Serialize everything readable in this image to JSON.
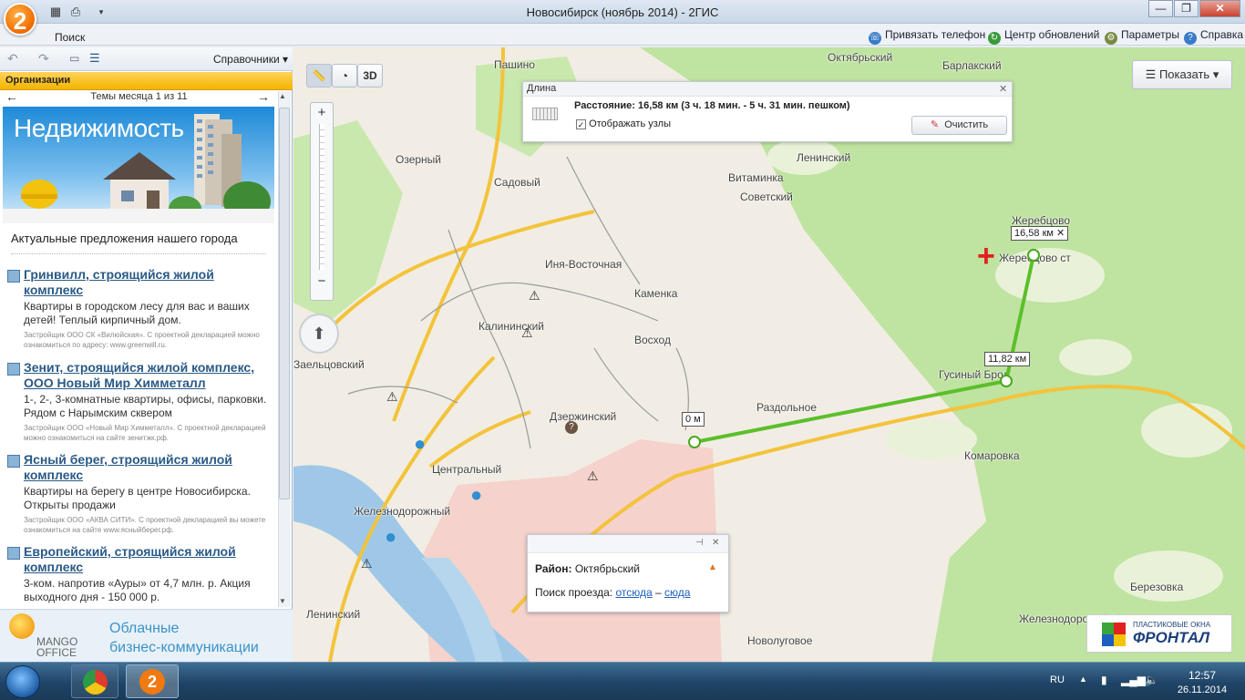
{
  "window": {
    "title": "Новосибирск (ноябрь 2014) - 2ГИС",
    "logo": "2",
    "minimize": "—",
    "maximize": "❐",
    "close": "✕"
  },
  "toolbar": {
    "search_tab": "Поиск",
    "links": [
      {
        "label": "Привязать телефон",
        "icon": "phone-icon"
      },
      {
        "label": "Центр обновлений",
        "icon": "refresh-icon"
      },
      {
        "label": "Параметры",
        "icon": "gear-icon"
      },
      {
        "label": "Справка",
        "icon": "help-icon"
      }
    ]
  },
  "sidebar": {
    "directories_label": "Справочники",
    "orgs_header": "Организации",
    "themes": "Темы месяца 1 из 11",
    "banner_title": "Недвижимость",
    "banner_caption": "Актуальные предложения нашего города",
    "items": [
      {
        "title": "Гринвилл, строящийся жилой комплекс",
        "desc": "Квартиры в городском лесу для вас и ваших детей! Теплый кирпичный дом.",
        "small": "Застройщик ООО СК «Вилюйская». С проектной декларацией можно ознакомиться по адресу: www.greenwill.ru."
      },
      {
        "title": "Зенит, строящийся жилой комплекс, ООО Новый Мир Химметалл",
        "desc": "1-, 2-, 3-комнатные квартиры, офисы, парковки. Рядом с Нарымским сквером",
        "small": "Застройщик ООО «Новый Мир Химметалл». С проектной декларацией можно ознакомиться на сайте зенитжк.рф."
      },
      {
        "title": "Ясный берег, строящийся жилой комплекс",
        "desc": "Квартиры на берегу в центре Новосибирска. Открыты продажи",
        "small": "Застройщик ООО «АКВА СИТИ». С проектной декларацией вы можете ознакомиться на сайте www.ясныйберег.рф."
      },
      {
        "title": "Европейский, строящийся жилой комплекс",
        "desc": "3-ком. напротив «Ауры» от 4,7 млн. р. Акция выходного дня - 150 000 р.",
        "small": ""
      }
    ],
    "ad": {
      "brand_top": "MANGO",
      "brand_bottom": "OFFICE",
      "slogan_1": "Облачные",
      "slogan_2": "бизнес-коммуникации"
    }
  },
  "map": {
    "btn_3d": "3D",
    "show_button": "Показать",
    "labels": [
      "Пашино",
      "Октябрьский",
      "Барлакский",
      "Озерный",
      "Садовый",
      "Витаминка",
      "Советский",
      "Ленинский",
      "Жеребцово",
      "Жеребцово ст",
      "Иня-Восточная",
      "Каменка",
      "Калининский",
      "Восход",
      "Заельцовский",
      "Гусиный Брод",
      "Раздольное",
      "Дзержинский",
      "Комаровка",
      "Центральный",
      "Железнодорожный",
      "Ленинский",
      "Новолуговое",
      "Березовка",
      "Железнодорожный"
    ],
    "measure": {
      "header": "Длина",
      "distance": "Расстояние: 16,58 км (3 ч. 18 мин. - 5 ч. 31 мин. пешком)",
      "show_nodes": "Отображать узлы",
      "clear_button": "Очистить"
    },
    "points": [
      {
        "label": "0 м"
      },
      {
        "label": "11,82 км"
      },
      {
        "label": "16,58 км"
      }
    ],
    "popup": {
      "district_key": "Район:",
      "district_value": "Октябрьский",
      "route_key": "Поиск проезда:",
      "route_from": "отсюда",
      "route_sep": "–",
      "route_to": "сюда"
    },
    "ad": {
      "top": "ПЛАСТИКОВЫЕ ОКНА",
      "brand": "ФРОНТАЛ"
    }
  },
  "taskbar": {
    "lang": "RU",
    "time": "12:57",
    "date": "26.11.2014",
    "apps": [
      "chrome-icon",
      "2gis-icon"
    ]
  },
  "colors": {
    "accent_orange": "#f4b400",
    "route_green": "#5bbf2a",
    "road_yellow": "#f3c33b",
    "forest_green": "#b9e29a",
    "water_blue": "#9fc8e8"
  }
}
